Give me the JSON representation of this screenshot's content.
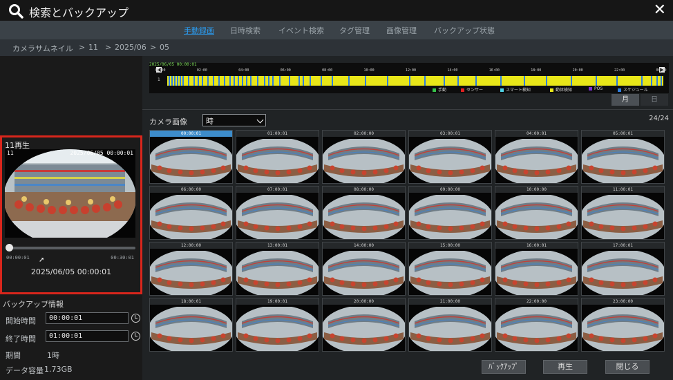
{
  "window": {
    "title": "検索とバックアップ",
    "close_label": "✕"
  },
  "tabs": [
    "手動録画",
    "日時検索",
    "イベント検索",
    "タグ管理",
    "画像管理",
    "バックアップ状態"
  ],
  "active_tab": 0,
  "breadcrumb": [
    "カメラサムネイル",
    ">",
    "11",
    ">",
    "2025/06",
    ">",
    "05"
  ],
  "player": {
    "title": "11再生",
    "channel": "11",
    "video_timestamp": "2025/06/05 00:00:01",
    "time_start": "00:00:01",
    "time_end": "00:30:01",
    "datetime": "2025/06/05 00:00:01",
    "progress": 0
  },
  "backup": {
    "title": "バックアップ情報",
    "start_label": "開始時間",
    "start_value": "00:00:01",
    "end_label": "終了時間",
    "end_value": "01:00:01",
    "period_label": "期間",
    "period_value": "1時",
    "size_label": "データ容量",
    "size_value": "1.73GB"
  },
  "timeline": {
    "date": "2025/06/05 00:00:01",
    "ticks": [
      "00:00",
      "02:00",
      "04:00",
      "06:00",
      "08:00",
      "10:00",
      "12:00",
      "14:00",
      "16:00",
      "18:00",
      "20:00",
      "22:00",
      "00:00"
    ],
    "channel": "1",
    "legend": [
      {
        "label": "手動",
        "color": "#36c24a"
      },
      {
        "label": "センサー",
        "color": "#e02020"
      },
      {
        "label": "スマート検知",
        "color": "#4fd2e6"
      },
      {
        "label": "動体検知",
        "color": "#e8e619"
      },
      {
        "label": "POS",
        "color": "#7a2fd6"
      },
      {
        "label": "スケジュール",
        "color": "#2f7fe0"
      }
    ],
    "view_buttons": {
      "month": "月",
      "day": "日"
    }
  },
  "thumbnails": {
    "label": "カメラ画像",
    "unit": "時",
    "count": "24/24",
    "times": [
      "00:00:01",
      "01:00:01",
      "02:00:00",
      "03:00:01",
      "04:00:01",
      "05:00:01",
      "06:00:00",
      "07:00:01",
      "08:00:00",
      "09:00:00",
      "10:00:00",
      "11:00:01",
      "12:00:00",
      "13:00:01",
      "14:00:00",
      "15:00:00",
      "16:00:01",
      "17:00:01",
      "18:00:01",
      "19:00:01",
      "20:00:00",
      "21:00:00",
      "22:00:00",
      "23:00:00"
    ],
    "selected_index": 0
  },
  "buttons": {
    "backup": "ﾊﾞｯｸｱｯﾌﾟ",
    "play": "再生",
    "close": "閉じる"
  },
  "colors": {
    "accent": "#2b9cf0",
    "highlight": "#d9261c",
    "motion": "#e8e619",
    "schedule": "#2f7fe0"
  }
}
